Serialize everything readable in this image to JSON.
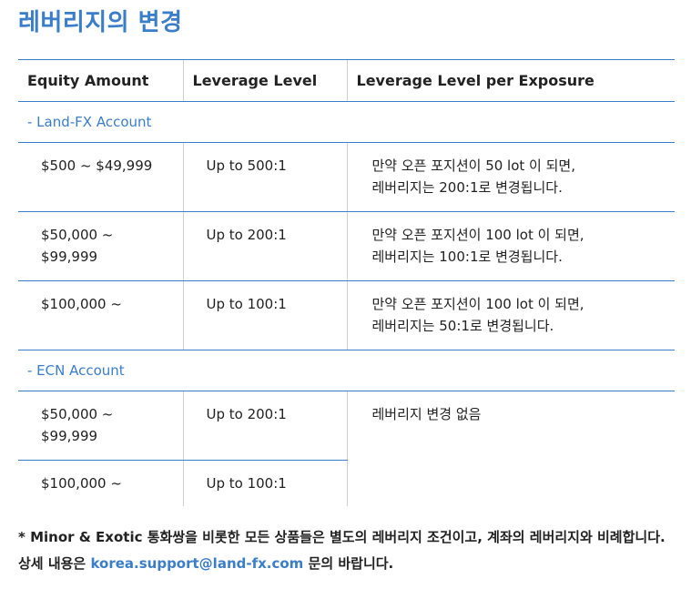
{
  "title": "레버리지의 변경",
  "table": {
    "headers": [
      "Equity Amount",
      "Leverage Level",
      "Leverage Level per Exposure"
    ],
    "sections": [
      {
        "label": "- Land-FX Account",
        "rows": [
          {
            "equity": "$500 ~ $49,999",
            "leverage": "Up to 500:1",
            "exposure_line1": "만약 오픈 포지션이 50 lot 이 되면,",
            "exposure_line2": "레버리지는 200:1로 변경됩니다."
          },
          {
            "equity_line1": "$50,000 ~",
            "equity_line2": "$99,999",
            "leverage": "Up to 200:1",
            "exposure_line1": "만약 오픈 포지션이 100 lot 이 되면,",
            "exposure_line2": "레버리지는 100:1로 변경됩니다."
          },
          {
            "equity": "$100,000 ~",
            "leverage": "Up to 100:1",
            "exposure_line1": "만약 오픈 포지션이 100 lot 이 되면,",
            "exposure_line2": "레버리지는 50:1로 변경됩니다."
          }
        ]
      },
      {
        "label": "- ECN Account",
        "rows": [
          {
            "equity_line1": "$50,000 ~",
            "equity_line2": "$99,999",
            "leverage": "Up to 200:1",
            "exposure": "레버리지 변경 없음"
          },
          {
            "equity": "$100,000 ~",
            "leverage": "Up to 100:1"
          }
        ]
      }
    ]
  },
  "note": {
    "text_before": "* Minor & Exotic 통화쌍을 비롯한 모든 상품들은 별도의 레버리지 조건이고, 계좌의 레버리지와 비례합니다. 상세 내용은 ",
    "email": "korea.support@land-fx.com",
    "text_after": " 문의 바랍니다."
  },
  "colors": {
    "accent": "#3a7dc9",
    "text": "#222222",
    "divider": "#d0d0d0"
  }
}
